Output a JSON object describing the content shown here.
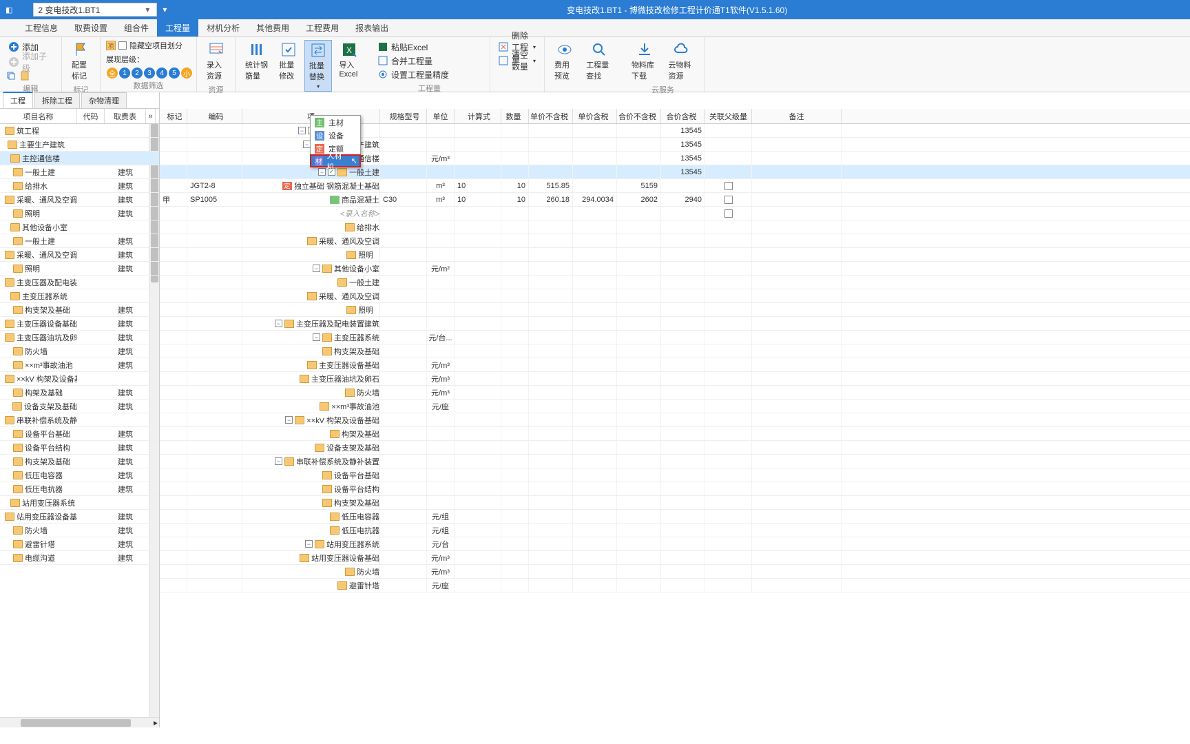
{
  "app": {
    "title": "变电技改1.BT1 - 博微技改检修工程计价通T1软件(V1.5.1.60)",
    "docName": "2 变电技改1.BT1"
  },
  "menu": {
    "tabs": [
      "工程信息",
      "取费设置",
      "组合件",
      "工程量",
      "材机分析",
      "其他费用",
      "工程费用",
      "报表输出"
    ],
    "active": 3
  },
  "ribbon": {
    "edit": {
      "add": "添加",
      "addChild": "添加子级",
      "label": "编辑"
    },
    "mark": {
      "config": "配置标记",
      "label": "标记"
    },
    "filter": {
      "hideEmpty": "隐藏空项目划分",
      "levelLabel": "展现层级：",
      "all": "全",
      "small": "小",
      "label": "数据筛选"
    },
    "resource": {
      "input": "录入资源",
      "label": "资源"
    },
    "batch": {
      "stat": "统计钢筋量",
      "modify": "批量修改",
      "replace": "批量替换",
      "import": "导入Excel"
    },
    "qty": {
      "paste": "粘贴Excel",
      "merge": "合并工程量",
      "precision": "设置工程量精度",
      "del": "删除工程量",
      "clear": "清空数量",
      "label": "工程量"
    },
    "view": {
      "preview": "费用预览",
      "lookup": "工程量查找"
    },
    "cloud": {
      "download": "物料库下载",
      "res": "云物料资源",
      "label": "云服务"
    }
  },
  "dropdown": {
    "items": [
      {
        "icon": "主",
        "bg": "#6fbf6f",
        "label": "主材"
      },
      {
        "icon": "设",
        "bg": "#5a8fd6",
        "label": "设备"
      },
      {
        "icon": "定",
        "bg": "#e96a50",
        "label": "定额"
      },
      {
        "icon": "材",
        "bg": "#7a7ad6",
        "label": "人材机"
      }
    ],
    "hl": 3
  },
  "docTabs": {
    "tabs": [
      "工程",
      "拆除工程",
      "杂物清理"
    ],
    "active": 0
  },
  "leftHead": {
    "name": "项目名称",
    "code": "代码",
    "fee": "取费表"
  },
  "leftRows": [
    {
      "name": "筑工程",
      "fee": "",
      "indent": 0
    },
    {
      "name": "主要生产建筑",
      "fee": "",
      "indent": 1
    },
    {
      "name": "主控通信楼",
      "fee": "",
      "indent": 2,
      "sel": true
    },
    {
      "name": "一般土建",
      "fee": "建筑",
      "indent": 3
    },
    {
      "name": "给排水",
      "fee": "建筑",
      "indent": 3
    },
    {
      "name": "采暖、通风及空调",
      "fee": "建筑",
      "indent": 3
    },
    {
      "name": "照明",
      "fee": "建筑",
      "indent": 3
    },
    {
      "name": "其他设备小室",
      "fee": "",
      "indent": 2
    },
    {
      "name": "一般土建",
      "fee": "建筑",
      "indent": 3
    },
    {
      "name": "采暖、通风及空调",
      "fee": "建筑",
      "indent": 3
    },
    {
      "name": "照明",
      "fee": "建筑",
      "indent": 3
    },
    {
      "name": "主变压器及配电装置建筑",
      "fee": "",
      "indent": 1
    },
    {
      "name": "主变压器系统",
      "fee": "",
      "indent": 2
    },
    {
      "name": "构支架及基础",
      "fee": "建筑",
      "indent": 3
    },
    {
      "name": "主变压器设备基础",
      "fee": "建筑",
      "indent": 3
    },
    {
      "name": "主变压器油坑及卵石",
      "fee": "建筑",
      "indent": 3
    },
    {
      "name": "防火墙",
      "fee": "建筑",
      "indent": 3
    },
    {
      "name": "××m³事故油池",
      "fee": "建筑",
      "indent": 3
    },
    {
      "name": "××kV 构架及设备基...",
      "fee": "",
      "indent": 2
    },
    {
      "name": "构架及基础",
      "fee": "建筑",
      "indent": 3
    },
    {
      "name": "设备支架及基础",
      "fee": "建筑",
      "indent": 3
    },
    {
      "name": "串联补偿系统及静补...",
      "fee": "",
      "indent": 2
    },
    {
      "name": "设备平台基础",
      "fee": "建筑",
      "indent": 3
    },
    {
      "name": "设备平台结构",
      "fee": "建筑",
      "indent": 3
    },
    {
      "name": "构支架及基础",
      "fee": "建筑",
      "indent": 3
    },
    {
      "name": "低压电容器",
      "fee": "建筑",
      "indent": 3
    },
    {
      "name": "低压电抗器",
      "fee": "建筑",
      "indent": 3
    },
    {
      "name": "站用变压器系统",
      "fee": "",
      "indent": 2
    },
    {
      "name": "站用变压器设备基础",
      "fee": "建筑",
      "indent": 3
    },
    {
      "name": "防火墙",
      "fee": "建筑",
      "indent": 3
    },
    {
      "name": "避雷针塔",
      "fee": "建筑",
      "indent": 3
    },
    {
      "name": "电缆沟道",
      "fee": "建筑",
      "indent": 3
    }
  ],
  "gridHead": [
    "标记",
    "编码",
    "项",
    "规格型号",
    "单位",
    "计算式",
    "数量",
    "单价不含税",
    "单价含税",
    "合价不含税",
    "合价含税",
    "关联父级量",
    "备注"
  ],
  "gridRows": [
    {
      "indent": 0,
      "exp": "-",
      "chk": true,
      "fol": true,
      "name": "建筑工程",
      "total2": "13545"
    },
    {
      "indent": 1,
      "exp": "-",
      "chk": true,
      "fol": true,
      "name": "主要生产建筑",
      "total2": "13545"
    },
    {
      "indent": 2,
      "exp": "-",
      "chk": true,
      "fol": true,
      "name": "主控通信楼",
      "unit": "元/m³",
      "total2": "13545"
    },
    {
      "indent": 3,
      "exp": "-",
      "chk": true,
      "fol": true,
      "name": "一般土建",
      "total2": "13545",
      "sel": true
    },
    {
      "mark": "",
      "code": "JGT2-8",
      "indent": 4,
      "ding": true,
      "name": "独立基础 钢筋混凝土基础",
      "unit": "m³",
      "formula": "10",
      "qty": "10",
      "p1": "515.85",
      "t1": "5159",
      "rel": true
    },
    {
      "mark": "甲",
      "code": "SP1005",
      "indent": 4,
      "cai": true,
      "name": "商品混凝土",
      "spec": "C30",
      "unit": "m³",
      "formula": "10",
      "qty": "10",
      "p1": "260.18",
      "p2": "294.0034",
      "t1": "2602",
      "t2": "2940",
      "rel": true
    },
    {
      "indent": 4,
      "hint": true,
      "name": "<录入名称>",
      "rel": true
    },
    {
      "indent": 3,
      "fol": true,
      "name": "给排水"
    },
    {
      "indent": 3,
      "fol": true,
      "name": "采暖、通风及空调"
    },
    {
      "indent": 3,
      "fol": true,
      "name": "照明"
    },
    {
      "indent": 2,
      "exp": "-",
      "fol": true,
      "name": "其他设备小室",
      "unit": "元/m²"
    },
    {
      "indent": 3,
      "fol": true,
      "name": "一般土建"
    },
    {
      "indent": 3,
      "fol": true,
      "name": "采暖、通风及空调"
    },
    {
      "indent": 3,
      "fol": true,
      "name": "照明"
    },
    {
      "indent": 1,
      "exp": "-",
      "fol": true,
      "name": "主变压器及配电装置建筑"
    },
    {
      "indent": 2,
      "exp": "-",
      "fol": true,
      "name": "主变压器系统",
      "unit": "元/台..."
    },
    {
      "indent": 3,
      "fol": true,
      "name": "构支架及基础"
    },
    {
      "indent": 3,
      "fol": true,
      "name": "主变压器设备基础",
      "unit": "元/m³"
    },
    {
      "indent": 3,
      "fol": true,
      "name": "主变压器油坑及卵石",
      "unit": "元/m³"
    },
    {
      "indent": 3,
      "fol": true,
      "name": "防火墙",
      "unit": "元/m³"
    },
    {
      "indent": 3,
      "fol": true,
      "name": "××m³事故油池",
      "unit": "元/座"
    },
    {
      "indent": 2,
      "exp": "-",
      "fol": true,
      "name": "××kV 构架及设备基础"
    },
    {
      "indent": 3,
      "fol": true,
      "name": "构架及基础"
    },
    {
      "indent": 3,
      "fol": true,
      "name": "设备支架及基础"
    },
    {
      "indent": 2,
      "exp": "-",
      "fol": true,
      "name": "串联补偿系统及静补装置"
    },
    {
      "indent": 3,
      "fol": true,
      "name": "设备平台基础"
    },
    {
      "indent": 3,
      "fol": true,
      "name": "设备平台结构"
    },
    {
      "indent": 3,
      "fol": true,
      "name": "构支架及基础"
    },
    {
      "indent": 3,
      "fol": true,
      "name": "低压电容器",
      "unit": "元/组"
    },
    {
      "indent": 3,
      "fol": true,
      "name": "低压电抗器",
      "unit": "元/组"
    },
    {
      "indent": 2,
      "exp": "-",
      "fol": true,
      "name": "站用变压器系统",
      "unit": "元/台"
    },
    {
      "indent": 3,
      "fol": true,
      "name": "站用变压器设备基础",
      "unit": "元/m³"
    },
    {
      "indent": 3,
      "fol": true,
      "name": "防火墙",
      "unit": "元/m³"
    },
    {
      "indent": 3,
      "fol": true,
      "name": "避雷针塔",
      "unit": "元/座"
    }
  ]
}
